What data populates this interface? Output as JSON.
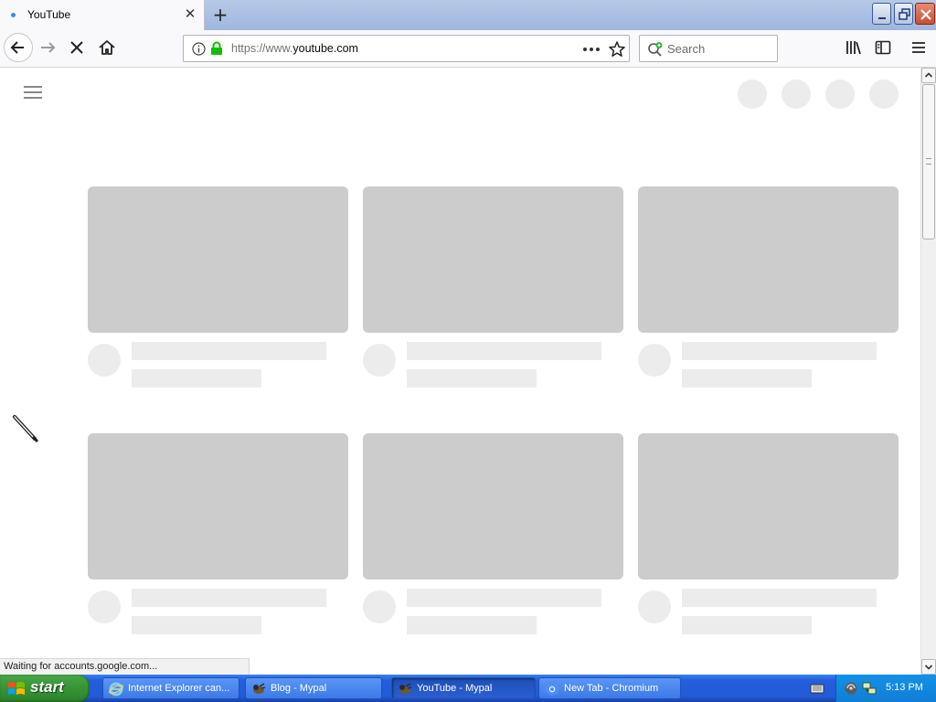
{
  "browser": {
    "tab": {
      "title": "YouTube"
    },
    "url": {
      "prefix": "https://www.",
      "host": "youtube.com"
    },
    "search": {
      "placeholder": "Search"
    }
  },
  "page": {
    "header_circles": 4,
    "video_cards": 6
  },
  "status": {
    "text": "Waiting for accounts.google.com..."
  },
  "taskbar": {
    "start_label": "start",
    "tasks": [
      {
        "label": "Internet Explorer can...",
        "icon": "ie-icon",
        "active": false
      },
      {
        "label": "Blog - Mypal",
        "icon": "mypal-icon",
        "active": false
      },
      {
        "label": "YouTube - Mypal",
        "icon": "mypal-icon",
        "active": true
      },
      {
        "label": "New Tab - Chromium",
        "icon": "chromium-icon",
        "active": false
      }
    ],
    "clock": "5:13 PM"
  },
  "colors": {
    "skeleton_thumb": "#cccccc",
    "skeleton_text": "#ececec",
    "taskbar_blue": "#245edc",
    "start_green": "#3c9b3c",
    "lock_green": "#12bc00"
  }
}
